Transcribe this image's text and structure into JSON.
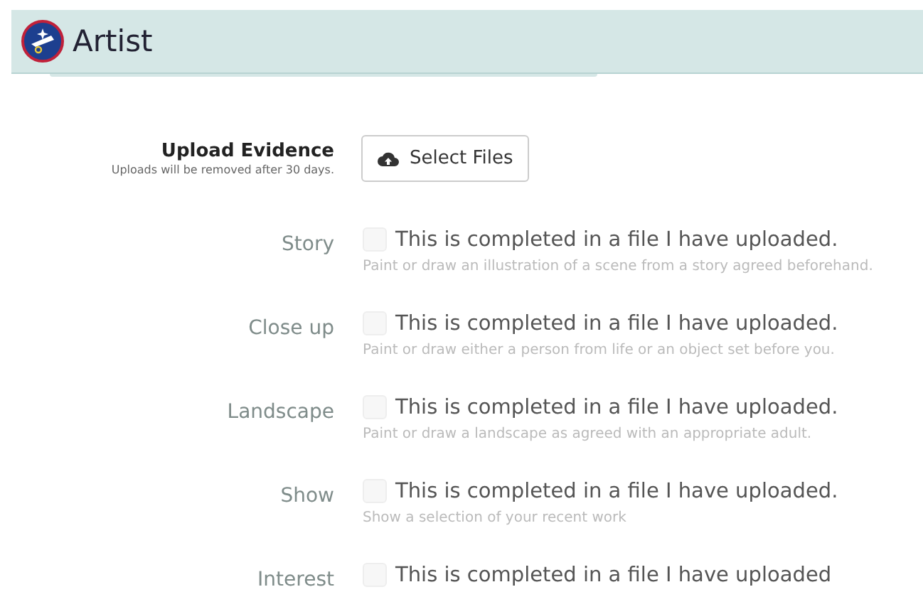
{
  "header": {
    "title": "Artist"
  },
  "upload": {
    "label": "Upload Evidence",
    "note": "Uploads will be removed after 30 days.",
    "button": "Select Files"
  },
  "requirements": [
    {
      "label": "Story",
      "checkbox": "This is completed in a file I have uploaded.",
      "checked": false,
      "description": "Paint or draw an illustration of a scene from a story agreed beforehand."
    },
    {
      "label": "Close up",
      "checkbox": "This is completed in a file I have uploaded.",
      "checked": false,
      "description": "Paint or draw either a person from life or an object set before you."
    },
    {
      "label": "Landscape",
      "checkbox": "This is completed in a file I have uploaded.",
      "checked": false,
      "description": "Paint or draw a landscape as agreed with an appropriate adult."
    },
    {
      "label": "Show",
      "checkbox": "This is completed in a file I have uploaded.",
      "checked": false,
      "description": "Show a selection of your recent work"
    },
    {
      "label": "Interest",
      "checkbox": "This is completed in a file I have uploaded",
      "checked": false
    }
  ]
}
